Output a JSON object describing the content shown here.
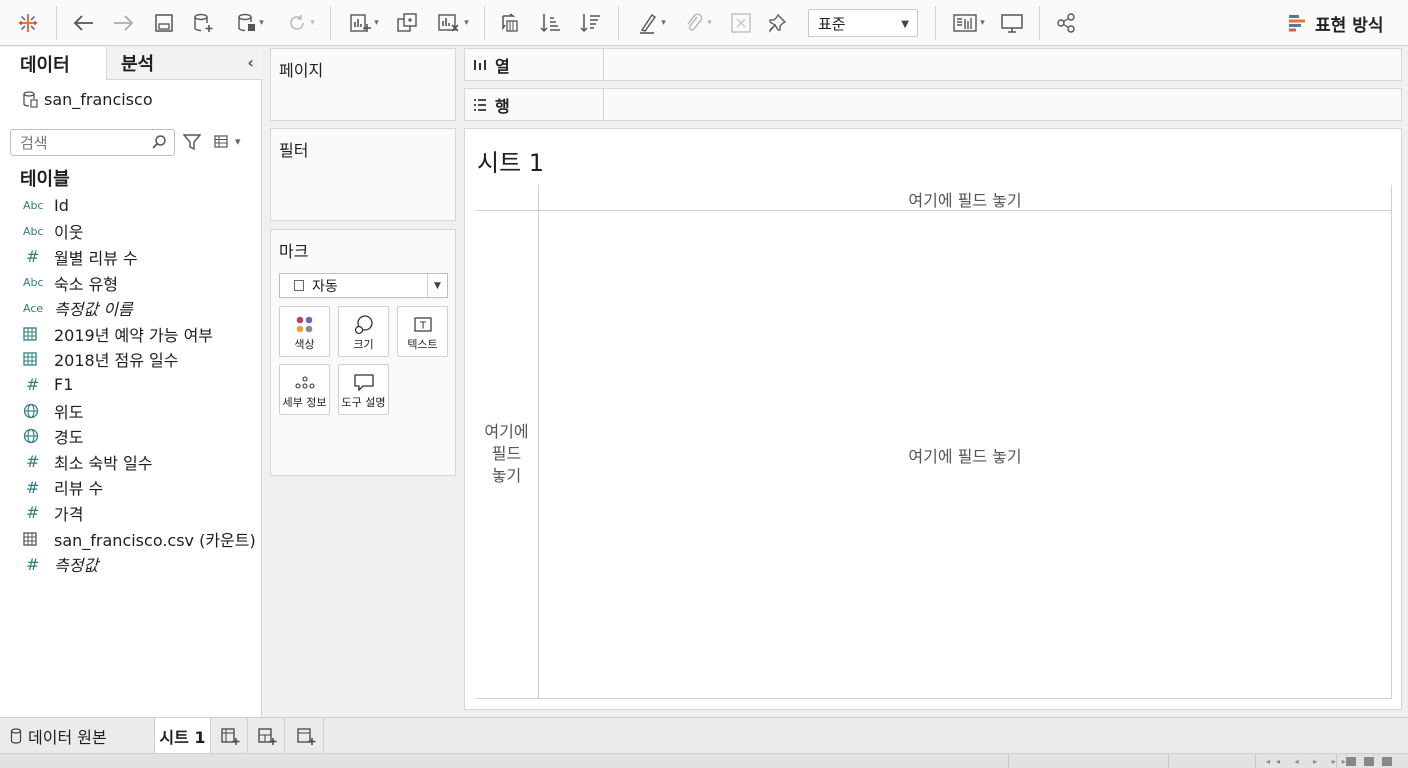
{
  "toolbar": {
    "fit_select": "표준",
    "show_me": "표현 방식",
    "colors": {
      "accent": "#e8762d",
      "teal": "#2e7f82"
    }
  },
  "data_pane": {
    "tab_data": "데이터",
    "tab_analytics": "분석",
    "datasource": "san_francisco",
    "search_placeholder": "검색",
    "tables_header": "테이블",
    "fields": [
      {
        "type": "Abc",
        "name": "Id"
      },
      {
        "type": "Abc",
        "name": "이웃"
      },
      {
        "type": "#",
        "name": "월별 리뷰 수"
      },
      {
        "type": "Abc",
        "name": "숙소 유형"
      },
      {
        "type": "Abc",
        "name": "측정값 이름"
      },
      {
        "type": "calendar",
        "name": "2019년 예약 가능 여부"
      },
      {
        "type": "calendar",
        "name": "2018년 점유 일수"
      },
      {
        "type": "#",
        "name": "F1"
      },
      {
        "type": "globe",
        "name": "위도"
      },
      {
        "type": "globe",
        "name": "경도"
      },
      {
        "type": "#",
        "name": "최소 숙박 일수"
      },
      {
        "type": "#",
        "name": "리뷰 수"
      },
      {
        "type": "#",
        "name": "가격"
      },
      {
        "type": "table",
        "name": "san_francisco.csv (카운트)"
      },
      {
        "type": "#",
        "name": "측정값"
      }
    ]
  },
  "cards": {
    "pages": "페이지",
    "filters": "필터",
    "marks": "마크",
    "mark_type": "자동",
    "mark_buttons": {
      "color": "색상",
      "size": "크기",
      "text": "텍스트",
      "detail": "세부 정보",
      "tooltip": "도구 설명"
    }
  },
  "shelves": {
    "columns": "열",
    "rows": "행"
  },
  "canvas": {
    "title": "시트 1",
    "drop_top": "여기에 필드 놓기",
    "drop_left_1": "여기에",
    "drop_left_2": "필드",
    "drop_left_3": "놓기",
    "drop_center": "여기에 필드 놓기"
  },
  "bottom_tabs": {
    "data_source": "데이터 원본",
    "sheet": "시트 1"
  }
}
